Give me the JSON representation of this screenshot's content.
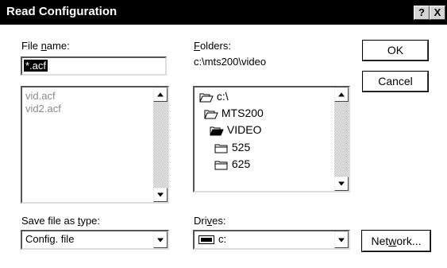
{
  "window": {
    "title": "Read Configuration"
  },
  "titlebar": {
    "help_label": "?",
    "close_label": "X"
  },
  "file_name": {
    "label_pre": "File ",
    "label_key": "n",
    "label_post": "ame:",
    "value": "*.acf"
  },
  "files": {
    "items": [
      "vid.acf",
      "vid2.acf"
    ]
  },
  "folders": {
    "label_key": "F",
    "label_post": "olders:",
    "current_path": "c:\\mts200\\video",
    "tree": [
      {
        "label": "c:\\",
        "icon": "open-folder-icon"
      },
      {
        "label": "MTS200",
        "icon": "open-folder-icon"
      },
      {
        "label": "VIDEO",
        "icon": "open-folder-icon"
      },
      {
        "label": "525",
        "icon": "closed-folder-icon"
      },
      {
        "label": "625",
        "icon": "closed-folder-icon"
      }
    ]
  },
  "save_type": {
    "label_pre": "Save file as ",
    "label_key": "t",
    "label_post": "ype:",
    "value": "Config. file"
  },
  "drives": {
    "label_pre": "Dri",
    "label_key": "v",
    "label_post": "es:",
    "value": "c:",
    "icon": "drive-icon"
  },
  "buttons": {
    "ok": "OK",
    "cancel": "Cancel",
    "network_pre": "Net",
    "network_key": "w",
    "network_post": "ork..."
  },
  "colors": {
    "titlebar": "#000000",
    "selection": "#000000",
    "disabled_text": "#8a8a8a"
  }
}
